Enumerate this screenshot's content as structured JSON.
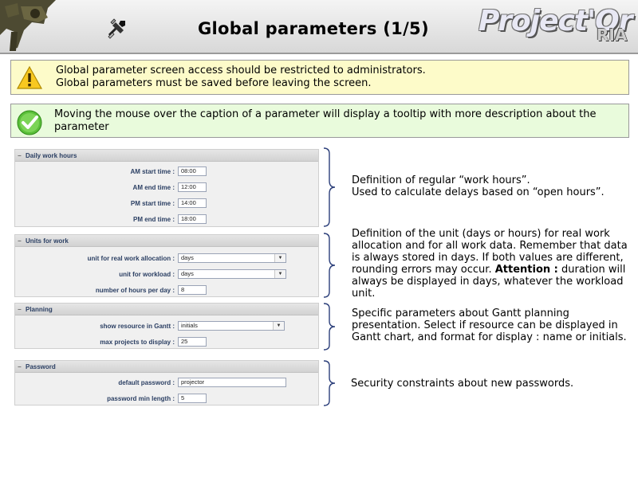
{
  "header": {
    "title": "Global parameters (1/5)",
    "product_name": "Project'Or",
    "product_suffix": "RIA"
  },
  "messages": {
    "warning": {
      "line1": "Global parameter screen access should be restricted to administrators.",
      "line2": "Global parameters must be saved before leaving the screen."
    },
    "info": {
      "text": "Moving the mouse over the caption of a parameter will display a tooltip with more description about the parameter"
    }
  },
  "panels": {
    "daily_work_hours": {
      "title": "Daily work hours",
      "rows": [
        {
          "label": "AM start time :",
          "value": "08:00"
        },
        {
          "label": "AM end time :",
          "value": "12:00"
        },
        {
          "label": "PM start time :",
          "value": "14:00"
        },
        {
          "label": "PM end time :",
          "value": "18:00"
        }
      ]
    },
    "units_for_work": {
      "title": "Units for work",
      "rows": [
        {
          "label": "unit for real work allocation :",
          "value": "days"
        },
        {
          "label": "unit for workload :",
          "value": "days"
        },
        {
          "label": "number of hours per day :",
          "value": "8"
        }
      ]
    },
    "planning": {
      "title": "Planning",
      "rows": [
        {
          "label": "show resource in Gantt :",
          "value": "initials"
        },
        {
          "label": "max projects to display :",
          "value": "25"
        }
      ]
    },
    "password": {
      "title": "Password",
      "rows": [
        {
          "label": "default password :",
          "value": "projector"
        },
        {
          "label": "password min length :",
          "value": "5"
        }
      ]
    }
  },
  "descriptions": {
    "daily_work_hours": {
      "line1": "Definition of regular “work hours”.",
      "line2": "Used to calculate delays based on “open hours”."
    },
    "units_for_work": {
      "text": "Definition of the unit (days or hours) for real work allocation and for all work data. Remember that data is always stored in days. If both values are different, rounding errors may occur.",
      "attention_label": "Attention :",
      "attention_text": " duration will always be displayed in days, whatever the workload unit."
    },
    "planning": {
      "text": "Specific parameters about Gantt planning presentation. Select if resource can be displayed in Gantt chart, and format for display : name or initials."
    },
    "password": {
      "text": "Security constraints about new passwords."
    }
  },
  "colors": {
    "label": "#2b3f63",
    "brace": "#2c3f7a",
    "warning_bg": "#fdfbc9",
    "info_bg": "#e9fbdc"
  },
  "icons": {
    "header_left": "camera-robot-logo",
    "header_tool": "tools-icon",
    "warning": "warning-icon",
    "info": "check-circle-icon"
  }
}
